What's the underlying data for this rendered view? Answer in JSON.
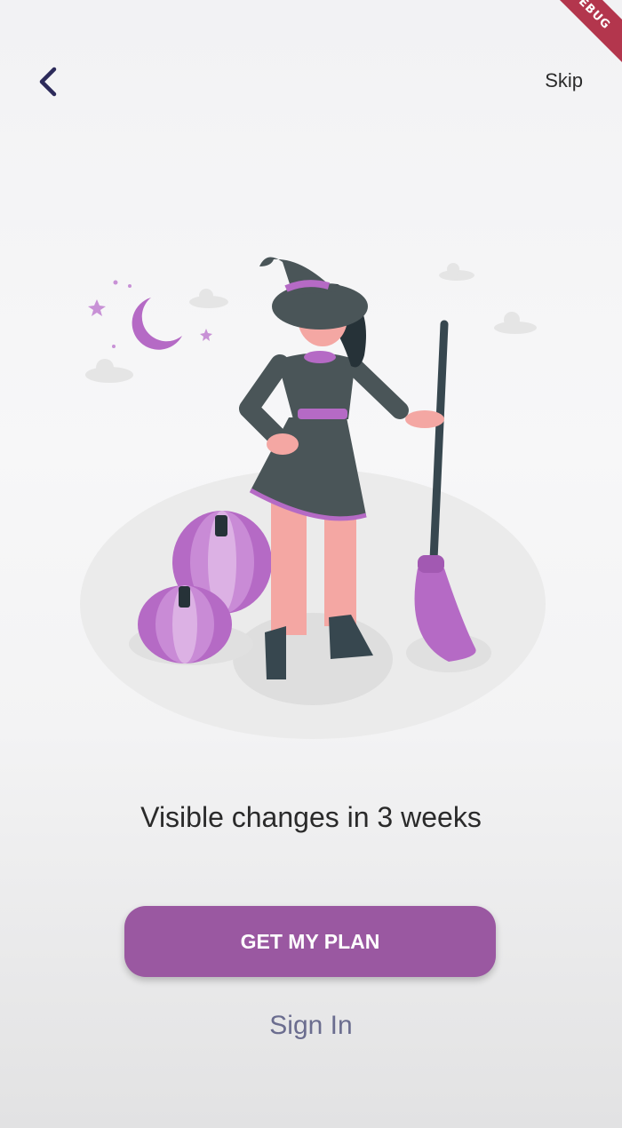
{
  "debug_banner": "DEBUG",
  "header": {
    "back_icon": "chevron-left-icon",
    "skip_label": "Skip"
  },
  "illustration": {
    "subject": "witch-with-broom-and-pumpkins",
    "colors": {
      "accent": "#b56ac5",
      "dress": "#4a5558",
      "skin": "#f4a7a3",
      "hair": "#263238",
      "pumpkin_light": "#d7a9e0",
      "shadow": "#ebebeb"
    }
  },
  "content": {
    "headline": "Visible changes in 3 weeks"
  },
  "actions": {
    "primary_label": "GET MY PLAN",
    "secondary_label": "Sign In"
  },
  "colors": {
    "primary_button": "#9a58a1",
    "link": "#6b6d8f",
    "back_icon": "#2c2a5a"
  }
}
